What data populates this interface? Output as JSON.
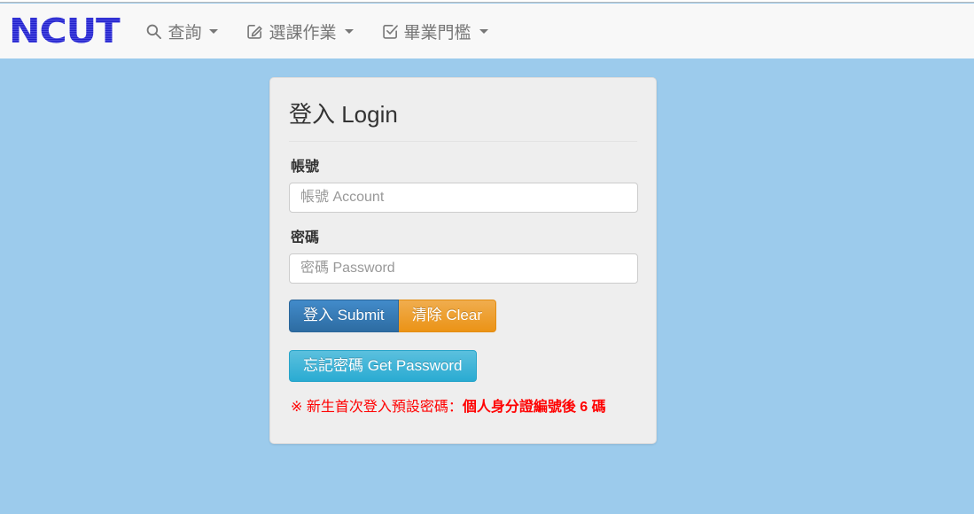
{
  "brand": {
    "logo_text": "NCUT",
    "logo_color": "#2222cc"
  },
  "navbar": {
    "items": [
      {
        "label": "查詢",
        "icon": "search-icon",
        "has_caret": true
      },
      {
        "label": "選課作業",
        "icon": "pencil-square-icon",
        "has_caret": true
      },
      {
        "label": "畢業門檻",
        "icon": "check-square-icon",
        "has_caret": true
      }
    ]
  },
  "login_panel": {
    "title": "登入 Login",
    "account": {
      "label": "帳號",
      "placeholder": "帳號 Account",
      "value": ""
    },
    "password": {
      "label": "密碼",
      "placeholder": "密碼 Password",
      "value": ""
    },
    "buttons": {
      "submit": "登入 Submit",
      "clear": "清除 Clear",
      "get_password": "忘記密碼 Get Password"
    },
    "note": {
      "prefix": "※ 新生首次登入預設密碼：",
      "emphasis": "個人身分證編號後 6 碼",
      "color": "#ff0000"
    }
  },
  "theme": {
    "page_background": "#9ccbec",
    "navbar_background": "#f8f8f8",
    "panel_background": "#eeeeee",
    "submit_color": "#428bca",
    "clear_color": "#f0ad4e",
    "get_password_color": "#5bc0de"
  }
}
